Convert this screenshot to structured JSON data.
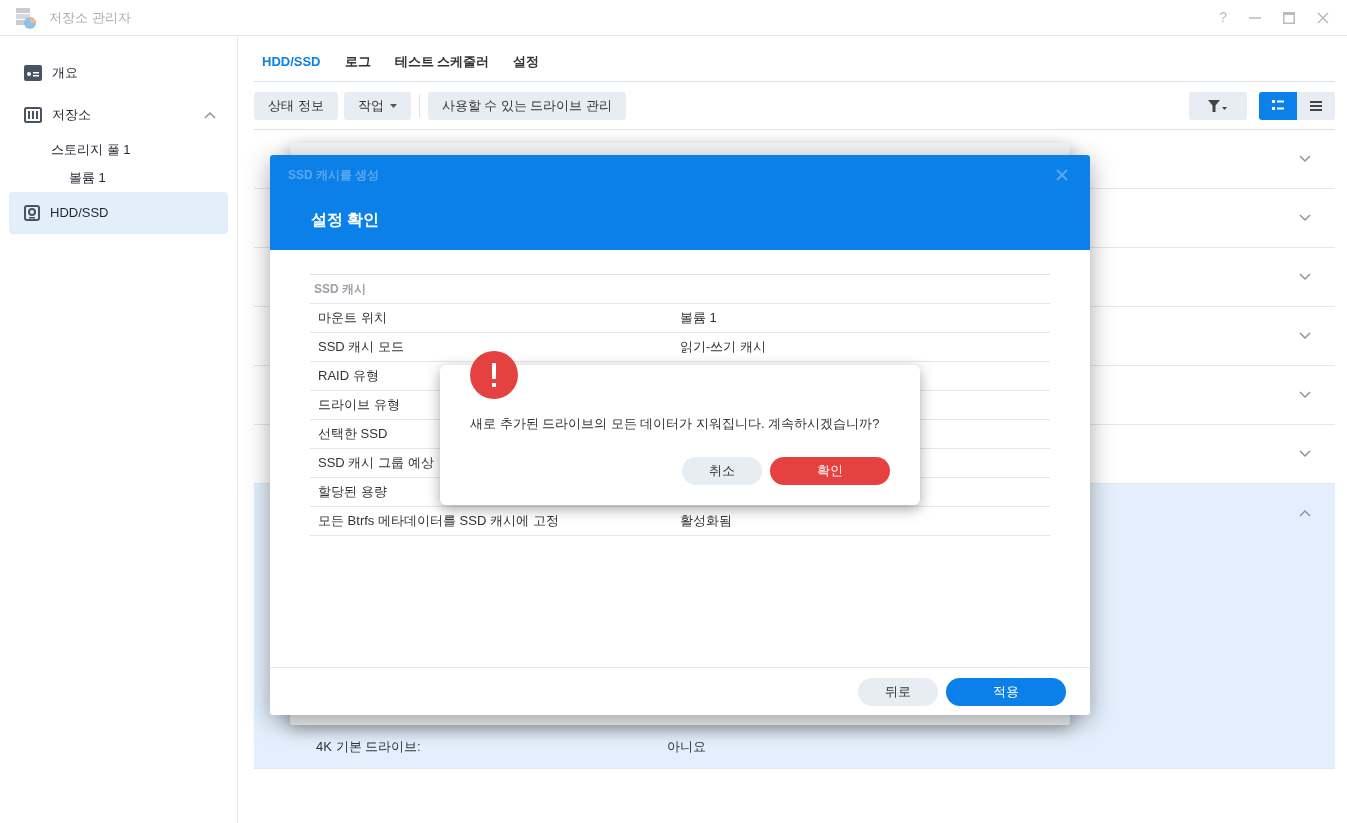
{
  "window": {
    "title": "저장소 관리자",
    "help": "?"
  },
  "sidebar": {
    "items": [
      {
        "label": "개요",
        "kind": "overview",
        "selected": false
      },
      {
        "label": "저장소",
        "kind": "storage",
        "selected": false,
        "expanded": true,
        "children": [
          {
            "label": "스토리지 풀 1",
            "selected": false,
            "children": [
              {
                "label": "볼륨 1",
                "selected": false
              }
            ]
          }
        ]
      },
      {
        "label": "HDD/SSD",
        "kind": "drive",
        "selected": true
      }
    ]
  },
  "tabs": [
    {
      "label": "HDD/SSD",
      "selected": true
    },
    {
      "label": "로그",
      "selected": false
    },
    {
      "label": "테스트 스케줄러",
      "selected": false
    },
    {
      "label": "설정",
      "selected": false
    }
  ],
  "toolbar": {
    "buttons": [
      {
        "label": "상태 정보",
        "dropdown": false
      },
      {
        "label": "작업",
        "dropdown": true
      },
      {
        "label": "사용할 수 있는 드라이브 관리",
        "dropdown": false
      }
    ],
    "view_modes": [
      {
        "kind": "grid",
        "selected": true
      },
      {
        "kind": "list",
        "selected": false
      }
    ]
  },
  "drive_list": [
    {
      "expanded": false
    },
    {
      "expanded": false
    },
    {
      "expanded": false
    },
    {
      "expanded": false
    },
    {
      "expanded": false
    },
    {
      "expanded": false
    },
    {
      "expanded": true,
      "details": [
        {
          "label": "4K 기본 드라이브:",
          "value": "아니요"
        }
      ]
    }
  ],
  "dialog": {
    "title": "SSD 캐시를 생성",
    "heading": "설정 확인",
    "section": "SSD 캐시",
    "rows": [
      {
        "label": "마운트 위치",
        "value": "볼륨 1"
      },
      {
        "label": "SSD 캐시 모드",
        "value": "읽기-쓰기 캐시"
      },
      {
        "label": "RAID 유형"
      },
      {
        "label": "드라이브 유형"
      },
      {
        "label": "선택한 SSD"
      },
      {
        "label": "SSD 캐시 그룹 예상"
      },
      {
        "label": "할당된 용량"
      },
      {
        "label": "모든 Btrfs 메타데이터를 SSD 캐시에 고정",
        "value": "활성화됨"
      }
    ],
    "buttons": [
      {
        "label": "뒤로",
        "kind": "secondary"
      },
      {
        "label": "적용",
        "kind": "primary"
      }
    ]
  },
  "alert": {
    "message": "새로 추가된 드라이브의 모든 데이터가 지워집니다. 계속하시겠습니까?",
    "buttons": [
      {
        "label": "취소",
        "kind": "secondary"
      },
      {
        "label": "확인",
        "kind": "danger"
      }
    ]
  }
}
